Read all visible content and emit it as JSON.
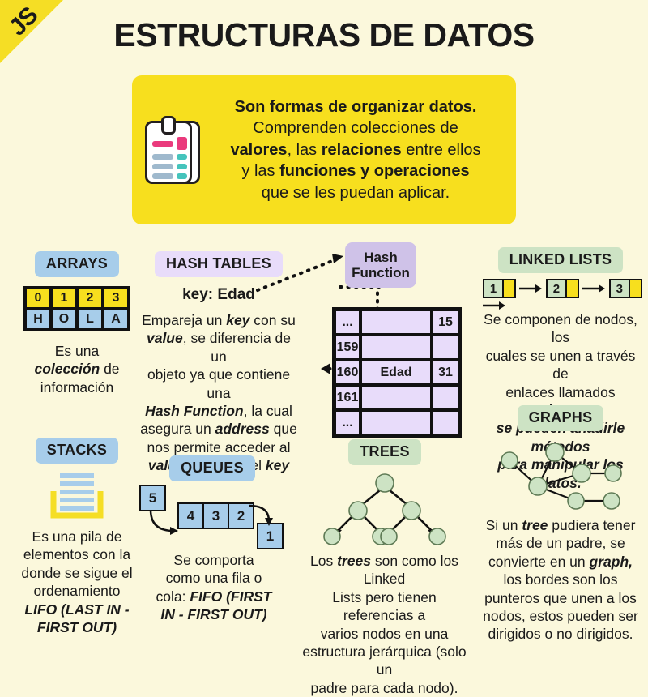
{
  "brand": {
    "logo_text": "JS"
  },
  "header": {
    "title": "ESTRUCTURAS DE DATOS"
  },
  "intro": {
    "icon": "clipboard-icon",
    "line1_bold": "Son formas de organizar datos.",
    "line2": "Comprenden colecciones de",
    "line3_a": "valores",
    "line3_b": ", las ",
    "line3_c": "relaciones",
    "line3_d": " entre ellos",
    "line4_a": "y las ",
    "line4_b": "funciones y operaciones",
    "line5": "que se les puedan aplicar."
  },
  "sections": {
    "arrays": {
      "label": "ARRAYS",
      "indices": [
        "0",
        "1",
        "2",
        "3"
      ],
      "values": [
        "H",
        "O",
        "L",
        "A"
      ],
      "desc_1": "Es una ",
      "desc_em": "colección",
      "desc_2": " de",
      "desc_3": "información"
    },
    "hash_tables": {
      "label": "HASH TABLES",
      "key_label": "key: Edad",
      "desc_1": "Empareja un ",
      "em_key": "key",
      "desc_2": " con su",
      "em_value": "value",
      "desc_3": ", se diferencia de un",
      "desc_4": "objeto ya que contiene una",
      "em_hashfn": "Hash Function",
      "desc_5": ", la cual",
      "desc_6": "asegura un ",
      "em_address": "address",
      "desc_7": " que",
      "desc_8": "nos permite acceder al",
      "em_value2": "value",
      "desc_9": " a través del ",
      "em_key2": "key",
      "hash_function_box": "Hash Function",
      "table_rows": [
        {
          "address": "...",
          "key": "",
          "value": "15"
        },
        {
          "address": "159",
          "key": "",
          "value": ""
        },
        {
          "address": "160",
          "key": "Edad",
          "value": "31"
        },
        {
          "address": "161",
          "key": "",
          "value": ""
        },
        {
          "address": "...",
          "key": "",
          "value": ""
        }
      ]
    },
    "linked_lists": {
      "label": "LINKED LISTS",
      "nodes": [
        "1",
        "2",
        "3"
      ],
      "desc_1": "Se componen de nodos, los",
      "desc_2": "cuales se unen a través de",
      "desc_3": "enlaces llamados ",
      "em_pointers": "pointers,",
      "em_line4": "se pueden añadirle métodos",
      "em_line5": "para manipular los datos."
    },
    "stacks": {
      "label": "STACKS",
      "icon": "stack-icon",
      "desc_1": "Es una pila de",
      "desc_2": "elementos con la",
      "desc_3": "donde se sigue el",
      "desc_4": "ordenamiento",
      "em_1": "LIFO (LAST IN -",
      "em_2": "FIRST OUT)"
    },
    "queues": {
      "label": "QUEUES",
      "incoming": "5",
      "queue": [
        "4",
        "3",
        "2"
      ],
      "outgoing": "1",
      "desc_1": "Se comporta",
      "desc_2": "como una fila o",
      "desc_3": "cola: ",
      "em_1": "FIFO (FIRST",
      "em_2": "IN - FIRST OUT)"
    },
    "trees": {
      "label": "TREES",
      "node_count": 7,
      "desc_1a": "Los ",
      "em_trees": "trees",
      "desc_1b": " son como los Linked",
      "desc_2": "Lists pero tienen referencias a",
      "desc_3": "varios nodos en una",
      "desc_4": "estructura jerárquica (solo un",
      "desc_5": "padre para cada nodo)."
    },
    "graphs": {
      "label": "GRAPHS",
      "node_count": 7,
      "desc_1a": "Si un ",
      "em_tree": "tree",
      "desc_1b": " pudiera tener",
      "desc_2": "más de un padre, se",
      "desc_3a": "convierte en un ",
      "em_graph": "graph,",
      "desc_4": "los bordes son los",
      "desc_5": "punteros que unen a los",
      "desc_6": "nodos, estos pueden ser",
      "desc_7": "dirigidos o no dirigidos."
    }
  },
  "colors": {
    "background": "#fbf8dc",
    "yellow": "#f7df1e",
    "badge_blue": "#a7cdea",
    "badge_purple": "#e8dcfa",
    "badge_green": "#cde3c4",
    "hash_fn_purple": "#cfc2e8",
    "node_green": "#cde3c4",
    "ink": "#1a1a1a"
  }
}
